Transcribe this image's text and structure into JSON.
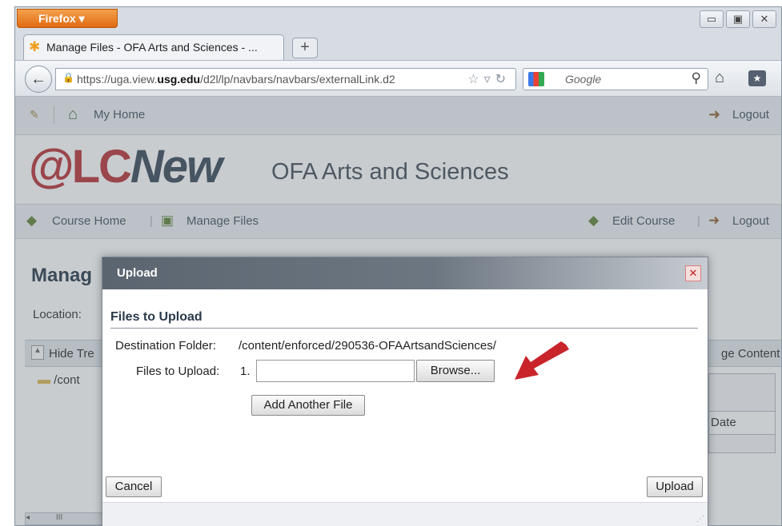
{
  "browser": {
    "app_button": "Firefox ▾",
    "tab_title": "Manage Files - OFA Arts and Sciences - ...",
    "new_tab": "+",
    "url_prefix": "https://uga.view.",
    "url_domain": "usg.edu",
    "url_rest": "/d2l/lp/navbars/navbars/externalLink.d2",
    "search_placeholder": "Google",
    "win_min": "▭",
    "win_max": "▣",
    "win_close": "✕"
  },
  "site": {
    "top_nav": {
      "home": "My Home",
      "logout": "Logout"
    },
    "logo": {
      "e": "@",
      "lc": "LC",
      "new": "New"
    },
    "banner_subtitle": "OFA Arts and Sciences",
    "course_nav": {
      "course_home": "Course Home",
      "manage_files": "Manage Files",
      "edit_course": "Edit Course",
      "logout": "Logout"
    },
    "page_title": "Manag",
    "location_label": "Location:",
    "hide_tree": "Hide Tre",
    "manage_content": "ge Content",
    "tree_root": "/cont",
    "date_header": "Date",
    "scroll_thumb": "III"
  },
  "dialog": {
    "title": "Upload",
    "section_title": "Files to Upload",
    "destination_label": "Destination Folder:",
    "destination_value": "/content/enforced/290536-OFAArtsandSciences/",
    "files_label": "Files to Upload:",
    "file_number": "1.",
    "file_value": "",
    "browse_button": "Browse...",
    "add_button": "Add Another File",
    "cancel_button": "Cancel",
    "upload_button": "Upload"
  },
  "annotation": {
    "arrow_color": "#c8242a"
  }
}
